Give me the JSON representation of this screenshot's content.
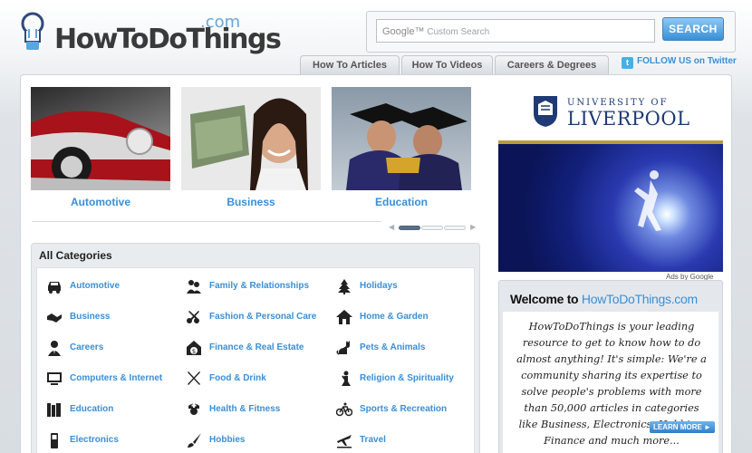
{
  "header": {
    "logo_text": "HowToDoThings",
    "logo_com": ".com"
  },
  "search": {
    "placeholder_brand": "Google™",
    "placeholder": "Custom Search",
    "button_label": "SEARCH"
  },
  "nav": {
    "tabs": [
      {
        "label": "How To Articles"
      },
      {
        "label": "How To Videos"
      },
      {
        "label": "Careers & Degrees"
      }
    ],
    "twitter_label": "FOLLOW US on Twitter"
  },
  "featured": [
    {
      "label": "Automotive",
      "image": "car-photo"
    },
    {
      "label": "Business",
      "image": "woman-money-photo"
    },
    {
      "label": "Education",
      "image": "graduates-photo"
    }
  ],
  "slider": {
    "pages": 3,
    "active": 1
  },
  "categories": {
    "title": "All Categories",
    "items": [
      {
        "label": "Automotive",
        "icon": "car-icon"
      },
      {
        "label": "Family & Relationships",
        "icon": "people-icon"
      },
      {
        "label": "Holidays",
        "icon": "tree-icon"
      },
      {
        "label": "Business",
        "icon": "handshake-icon"
      },
      {
        "label": "Fashion & Personal Care",
        "icon": "scissors-icon"
      },
      {
        "label": "Home & Garden",
        "icon": "house-icon"
      },
      {
        "label": "Careers",
        "icon": "person-icon"
      },
      {
        "label": "Finance & Real Estate",
        "icon": "money-house-icon"
      },
      {
        "label": "Pets & Animals",
        "icon": "cat-icon"
      },
      {
        "label": "Computers & Internet",
        "icon": "computer-icon"
      },
      {
        "label": "Food & Drink",
        "icon": "fork-knife-icon"
      },
      {
        "label": "Religion & Spirituality",
        "icon": "praying-icon"
      },
      {
        "label": "Education",
        "icon": "books-icon"
      },
      {
        "label": "Health & Fitness",
        "icon": "nurse-icon"
      },
      {
        "label": "Sports & Recreation",
        "icon": "bicycle-icon"
      },
      {
        "label": "Electronics",
        "icon": "phone-icon"
      },
      {
        "label": "Hobbies",
        "icon": "brush-icon"
      },
      {
        "label": "Travel",
        "icon": "plane-icon"
      }
    ]
  },
  "ad": {
    "university_line": "UNIVERSITY OF",
    "university_name": "LIVERPOOL",
    "ads_by": "Ads by Google"
  },
  "welcome": {
    "title_prefix": "Welcome to ",
    "title_site": "HowToDoThings.com",
    "text": "HowToDoThings is your leading resource to get to know how to do almost anything! It's simple: We're a community sharing its expertise to solve people's problems with more than 50,000 articles in categories like Business, Electronics, Hobbies, Finance and much more...",
    "learn_more": "LEARN MORE ►"
  },
  "colors": {
    "accent": "#3a8fd6",
    "navy": "#1f3a74"
  }
}
